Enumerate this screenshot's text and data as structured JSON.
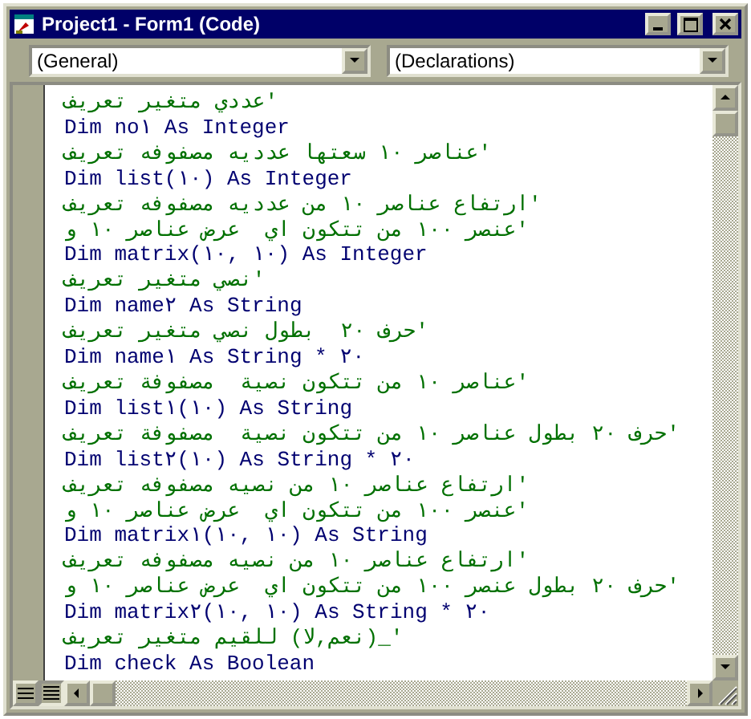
{
  "window": {
    "title": "Project1 - Form1 (Code)"
  },
  "object_box": {
    "value": "(General)"
  },
  "procedure_box": {
    "value": "(Declarations)"
  },
  "code_lines": [
    {
      "kind": "comment",
      "text": "تعريف متغير عددي'"
    },
    {
      "kind": "code",
      "text": "Dim no١ As Integer"
    },
    {
      "kind": "comment",
      "text": "تعريف مصفوفه عدديه سعتها ١٠ عناصر'"
    },
    {
      "kind": "code",
      "text": "Dim list(١٠) As Integer"
    },
    {
      "kind": "comment",
      "text": "تعريف مصفوفه عدديه من ١٠ عناصر ارتفاع'"
    },
    {
      "kind": "comment",
      "text": "و ١٠ عناصر عرض  اي تتكون من ١٠٠ عنصر'"
    },
    {
      "kind": "code",
      "text": "Dim matrix(١٠, ١٠) As Integer"
    },
    {
      "kind": "comment",
      "text": "تعريف متغير نصي'"
    },
    {
      "kind": "code",
      "text": "Dim name٢ As String"
    },
    {
      "kind": "comment",
      "text": "تعريف متغير نصي بطول  ٢٠ حرف'"
    },
    {
      "kind": "code",
      "text": "Dim name١ As String * ٢٠"
    },
    {
      "kind": "comment",
      "text": "تعريف مصفوفة  نصية تتكون من ١٠ عناصر'"
    },
    {
      "kind": "code",
      "text": "Dim list١(١٠) As String"
    },
    {
      "kind": "comment",
      "text": "تعريف مصفوفة  نصية تتكون من ١٠ عناصر بطول ٢٠ حرف'"
    },
    {
      "kind": "code",
      "text": "Dim list٢(١٠) As String * ٢٠"
    },
    {
      "kind": "comment",
      "text": "تعريف مصفوفه نصيه من ١٠ عناصر ارتفاع'"
    },
    {
      "kind": "comment",
      "text": "و ١٠ عناصر عرض  اي تتكون من ١٠٠ عنصر'"
    },
    {
      "kind": "code",
      "text": "Dim matrix١(١٠, ١٠) As String"
    },
    {
      "kind": "comment",
      "text": "تعريف مصفوفه نصيه من ١٠ عناصر ارتفاع'"
    },
    {
      "kind": "comment",
      "text": "و ١٠ عناصر عرض  اي تتكون من ١٠٠ عنصر بطول ٢٠ حرف'"
    },
    {
      "kind": "code",
      "text": "Dim matrix٢(١٠, ١٠) As String * ٢٠"
    },
    {
      "kind": "comment",
      "text": "تعريف متغير للقيم (نعم,لا)_'"
    },
    {
      "kind": "code",
      "text": "Dim check As Boolean"
    }
  ]
}
